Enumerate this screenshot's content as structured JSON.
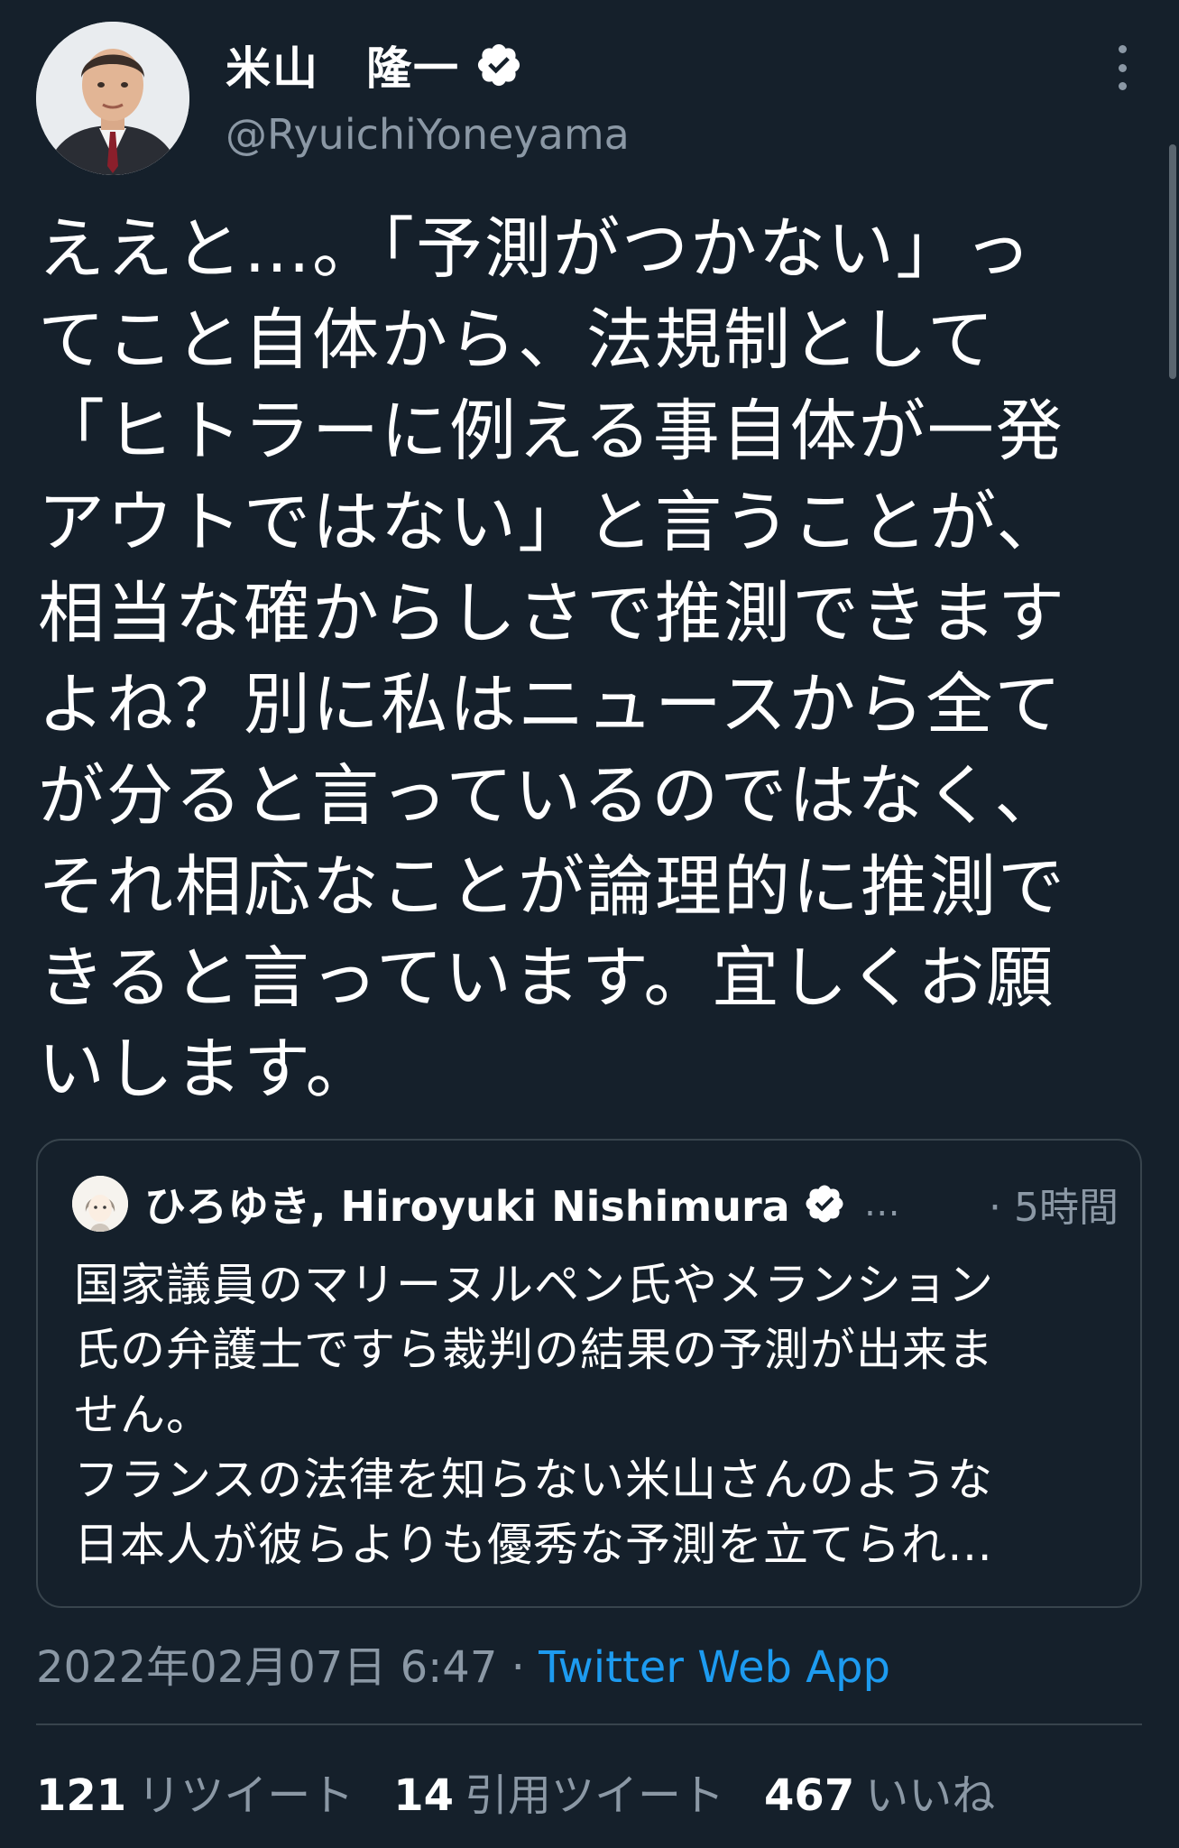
{
  "author": {
    "display_name": "米山　隆一",
    "handle": "@RyuichiYoneyama",
    "verified": true
  },
  "tweet": {
    "lines": [
      "ええと…。「予測がつかない」っ",
      "てこと自体から、法規制として",
      "「ヒトラーに例える事自体が一発",
      "アウトではない」と言うことが、",
      "相当な確からしさで推測できます",
      "よね？別に私はニュースから全て",
      "が分ると言っているのではなく、",
      "それ相応なことが論理的に推測で",
      "きると言っています。宜しくお願",
      "いします。"
    ]
  },
  "quote": {
    "author_name": "ひろゆき, Hiroyuki Nishimura",
    "ellipsis": "…",
    "time": "· 5時間",
    "lines": [
      "国家議員のマリーヌルペン氏やメランション",
      "氏の弁護士ですら裁判の結果の予測が出来ま",
      "せん。",
      "フランスの法律を知らない米山さんのような",
      "日本人が彼らよりも優秀な予測を立てられ…"
    ]
  },
  "meta": {
    "date": "2022年02月07日 6:47",
    "separator": " · ",
    "source": "Twitter Web App"
  },
  "stats": [
    {
      "count": "121",
      "label": "リツイート"
    },
    {
      "count": "14",
      "label": "引用ツイート"
    },
    {
      "count": "467",
      "label": "いいね"
    }
  ],
  "colors": {
    "background": "#15202b",
    "text": "#ffffff",
    "secondary": "#8b98a5",
    "link": "#1d9bf0",
    "border": "#38444d"
  }
}
